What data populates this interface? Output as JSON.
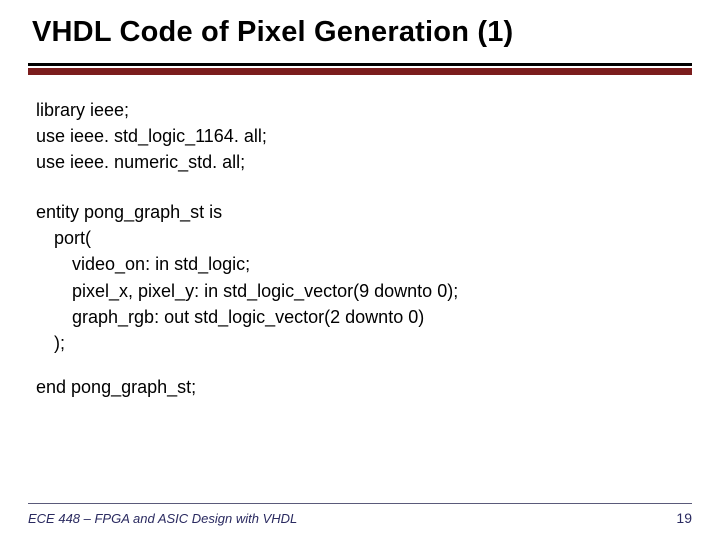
{
  "title": "VHDL Code of Pixel Generation (1)",
  "code": {
    "l1": "library ieee;",
    "l2": "use ieee. std_logic_1164. all;",
    "l3": "use ieee. numeric_std. all;",
    "l4": "entity pong_graph_st is",
    "l5": "port(",
    "l6": "video_on: in std_logic;",
    "l7": "pixel_x, pixel_y: in std_logic_vector(9 downto 0);",
    "l8": "graph_rgb: out std_logic_vector(2 downto 0)",
    "l9": ");",
    "l10": "end pong_graph_st;"
  },
  "footer": {
    "course": "ECE 448 – FPGA and ASIC Design with VHDL",
    "page": "19"
  }
}
